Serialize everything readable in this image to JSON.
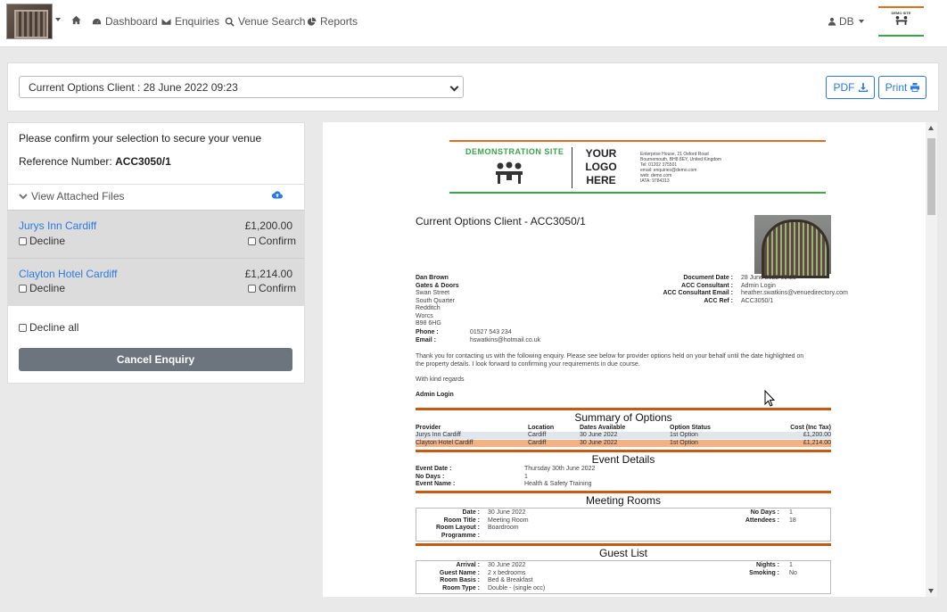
{
  "nav": {
    "dashboard": "Dashboard",
    "enquiries": "Enquiries",
    "venue_search": "Venue Search",
    "reports": "Reports",
    "user": "DB",
    "brand_logo_text": "DEMO SITE"
  },
  "toolbar": {
    "select_value": "Current Options Client : 28 June 2022 09:23",
    "pdf_label": "PDF",
    "print_label": "Print"
  },
  "confirm_panel": {
    "intro": "Please confirm your selection to secure your venue",
    "ref_label": "Reference Number:",
    "ref_value": "ACC3050/1",
    "attached_files": "View Attached Files",
    "venues": [
      {
        "name": "Jurys Inn Cardiff",
        "price": "£1,200.00",
        "decline": "Decline",
        "confirm": "Confirm"
      },
      {
        "name": "Clayton Hotel Cardiff",
        "price": "£1,214.00",
        "decline": "Decline",
        "confirm": "Confirm"
      }
    ],
    "decline_all": "Decline all",
    "cancel": "Cancel Enquiry"
  },
  "document": {
    "logo_demo": "DEMONSTRATION SITE",
    "logo_your": "YOUR LOGO HERE",
    "logo_addr_1": "Enterprise House, 21 Oxford Road",
    "logo_addr_2": "Bournemouth, BH8 8EY, United Kingdom",
    "logo_addr_3": "Tel: 01202 375501",
    "logo_addr_4": "email: enquiries@demo.com",
    "logo_addr_5": "web: demo.com",
    "logo_addr_6": "IATA: 9784313",
    "title": "Current Options Client - ACC3050/1",
    "client": {
      "name": "Dan Brown",
      "company": "Gates & Doors",
      "addr1": "Swan Street",
      "addr2": "South Quarter",
      "addr3": "Redditch",
      "addr4": "Worcs",
      "addr5": "B98 6HG",
      "phone_label": "Phone :",
      "phone": "01527 543 234",
      "email_label": "Email :",
      "email": "hswatkins@hotmail.co.uk"
    },
    "meta": {
      "doc_date_label": "Document Date :",
      "doc_date": "28 June 2022 09:23",
      "consultant_label": "ACC Consultant :",
      "consultant": "Admin Login",
      "consultant_email_label": "ACC Consultant Email :",
      "consultant_email": "heather.swatkins@venuedirectory.com",
      "ref_label": "ACC Ref :",
      "ref": "ACC3050/1"
    },
    "body1": "Thank you for contacting us with the following enquiry. Please see below for provider options held on your behalf until the date highlighted on",
    "body2": "the property details. I look forward to confirming your requirements in due course.",
    "regards": "With kind regards",
    "signer": "Admin Login",
    "summary": {
      "heading": "Summary of Options",
      "headers": [
        "Provider",
        "Location",
        "Dates Available",
        "Option Status",
        "Cost (Inc Tax)"
      ],
      "rows": [
        [
          "Jurys Inn Cardiff",
          "Cardiff",
          "30 June 2022",
          "1st Option",
          "£1,200.00"
        ],
        [
          "Clayton Hotel Cardiff",
          "Cardiff",
          "30 June 2022",
          "1st Option",
          "£1,214.00"
        ]
      ]
    },
    "event": {
      "heading": "Event Details",
      "date_label": "Event Date :",
      "date": "Thursday 30th June 2022",
      "days_label": "No Days :",
      "days": "1",
      "name_label": "Event Name :",
      "name": "Health & Safety Training"
    },
    "meeting": {
      "heading": "Meeting Rooms",
      "date_label": "Date :",
      "date": "30 June 2022",
      "title_label": "Room Title :",
      "title": "Meeting Room",
      "layout_label": "Room Layout :",
      "layout": "Boardroom",
      "programme_label": "Programme :",
      "nodays_label": "No Days :",
      "nodays": "1",
      "attendees_label": "Attendees :",
      "attendees": "18"
    },
    "guest": {
      "heading": "Guest List",
      "arrival_label": "Arrival :",
      "arrival": "30 June 2022",
      "guestname_label": "Guest Name :",
      "guestname": "2 x bedrooms",
      "basis_label": "Room Basis :",
      "basis": "Bed & Breakfast",
      "type_label": "Room Type :",
      "type": "Double - (single occ)",
      "nights_label": "Nights :",
      "nights": "1",
      "smoking_label": "Smoking :",
      "smoking": "No"
    }
  }
}
